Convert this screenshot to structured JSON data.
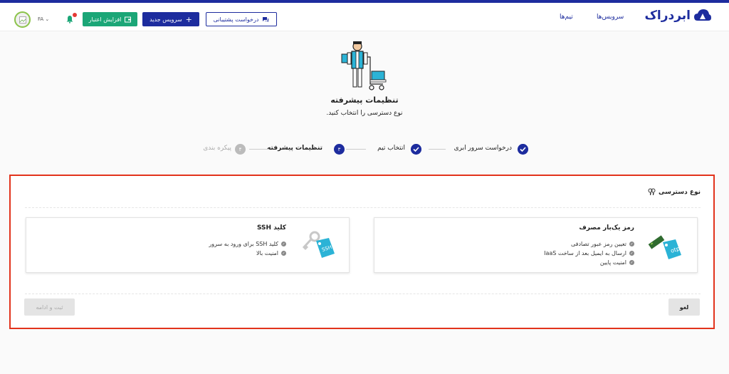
{
  "header": {
    "logo_text": "ابردراک",
    "nav": {
      "services": "سرویس‌ها",
      "teams": "تیم‌ها"
    },
    "support_button": "درخواست پشتیبانی",
    "new_service_button": "سرویس جدید",
    "add_credit_button": "افزایش اعتبار",
    "lang": "FA"
  },
  "hero": {
    "title": "تنظیمات پیشرفته",
    "subtitle": "نوع دسترسی را انتخاب کنید."
  },
  "steps": [
    {
      "label": "درخواست سرور ابری",
      "status": "done"
    },
    {
      "label": "انتخاب تیم",
      "status": "done",
      "number": ""
    },
    {
      "label": "تنظیمات پیشرفته",
      "status": "current",
      "number": "۳"
    },
    {
      "label": "پیکره بندی",
      "status": "pending",
      "number": "۴"
    }
  ],
  "panel": {
    "title": "نوع دسترسی",
    "otp_card": {
      "title": "رمز یک‌بار مصرف",
      "features": [
        "تعیین رمز عبور تصادفی",
        "ارسال به ایمیل بعد از ساخت IaaS",
        "امنیت پایین"
      ],
      "tag": "otp"
    },
    "ssh_card": {
      "title": "کلید SSH",
      "features": [
        "کلید SSH برای ورود به سرور",
        "امنیت بالا"
      ],
      "tag": "SSH"
    },
    "cancel_button": "لغو",
    "submit_button": "ثبت و ادامه"
  },
  "colors": {
    "brand": "#1d2c9e",
    "green": "#1ba677",
    "highlight": "#e2331c",
    "tag": "#2bb3d6"
  }
}
